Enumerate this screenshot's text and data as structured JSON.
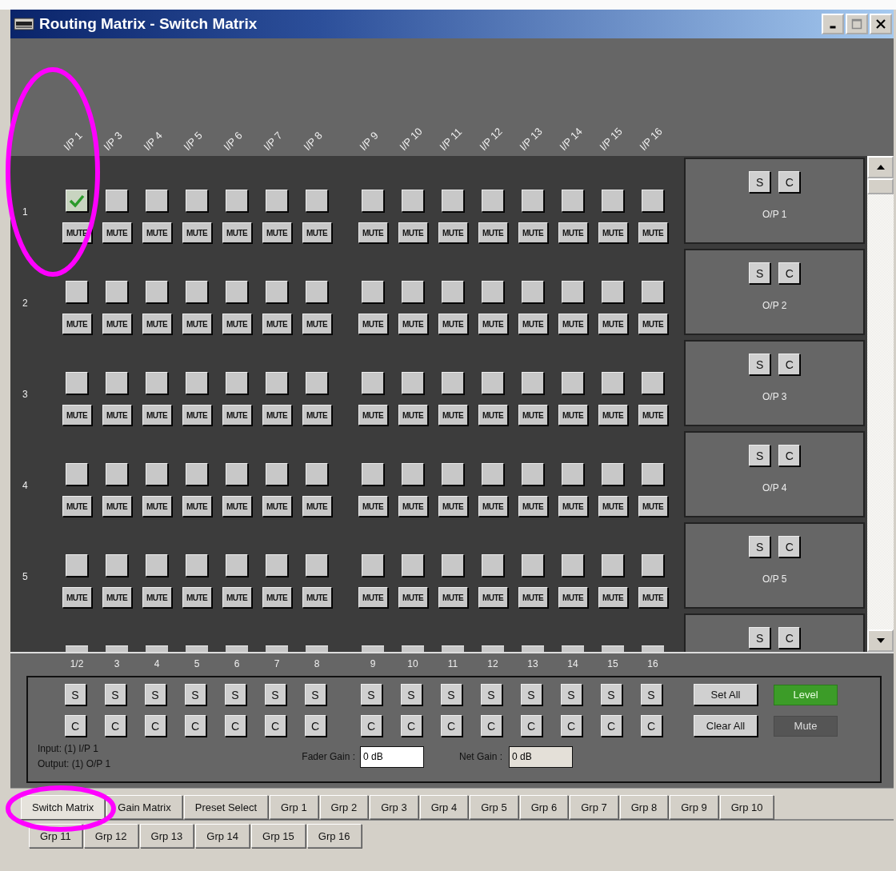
{
  "window": {
    "title": "Routing Matrix - Switch Matrix"
  },
  "input_headers": [
    "I/P 1",
    "I/P 3",
    "I/P 4",
    "I/P 5",
    "I/P 6",
    "I/P 7",
    "I/P 8",
    "I/P 9",
    "I/P 10",
    "I/P 11",
    "I/P 12",
    "I/P 13",
    "I/P 14",
    "I/P 15",
    "I/P 16"
  ],
  "rows": [
    {
      "label": "1",
      "cells": [
        {
          "checked": true,
          "mute": "MUTE"
        },
        {
          "checked": false,
          "mute": "MUTE"
        },
        {
          "checked": false,
          "mute": "MUTE"
        },
        {
          "checked": false,
          "mute": "MUTE"
        },
        {
          "checked": false,
          "mute": "MUTE"
        },
        {
          "checked": false,
          "mute": "MUTE"
        },
        {
          "checked": false,
          "mute": "MUTE"
        },
        {
          "checked": false,
          "mute": "MUTE"
        },
        {
          "checked": false,
          "mute": "MUTE"
        },
        {
          "checked": false,
          "mute": "MUTE"
        },
        {
          "checked": false,
          "mute": "MUTE"
        },
        {
          "checked": false,
          "mute": "MUTE"
        },
        {
          "checked": false,
          "mute": "MUTE"
        },
        {
          "checked": false,
          "mute": "MUTE"
        },
        {
          "checked": false,
          "mute": "MUTE"
        }
      ]
    },
    {
      "label": "2",
      "cells": [
        {
          "checked": false,
          "mute": "MUTE"
        },
        {
          "checked": false,
          "mute": "MUTE"
        },
        {
          "checked": false,
          "mute": "MUTE"
        },
        {
          "checked": false,
          "mute": "MUTE"
        },
        {
          "checked": false,
          "mute": "MUTE"
        },
        {
          "checked": false,
          "mute": "MUTE"
        },
        {
          "checked": false,
          "mute": "MUTE"
        },
        {
          "checked": false,
          "mute": "MUTE"
        },
        {
          "checked": false,
          "mute": "MUTE"
        },
        {
          "checked": false,
          "mute": "MUTE"
        },
        {
          "checked": false,
          "mute": "MUTE"
        },
        {
          "checked": false,
          "mute": "MUTE"
        },
        {
          "checked": false,
          "mute": "MUTE"
        },
        {
          "checked": false,
          "mute": "MUTE"
        },
        {
          "checked": false,
          "mute": "MUTE"
        }
      ]
    },
    {
      "label": "3",
      "cells": [
        {
          "checked": false,
          "mute": "MUTE"
        },
        {
          "checked": false,
          "mute": "MUTE"
        },
        {
          "checked": false,
          "mute": "MUTE"
        },
        {
          "checked": false,
          "mute": "MUTE"
        },
        {
          "checked": false,
          "mute": "MUTE"
        },
        {
          "checked": false,
          "mute": "MUTE"
        },
        {
          "checked": false,
          "mute": "MUTE"
        },
        {
          "checked": false,
          "mute": "MUTE"
        },
        {
          "checked": false,
          "mute": "MUTE"
        },
        {
          "checked": false,
          "mute": "MUTE"
        },
        {
          "checked": false,
          "mute": "MUTE"
        },
        {
          "checked": false,
          "mute": "MUTE"
        },
        {
          "checked": false,
          "mute": "MUTE"
        },
        {
          "checked": false,
          "mute": "MUTE"
        },
        {
          "checked": false,
          "mute": "MUTE"
        }
      ]
    },
    {
      "label": "4",
      "cells": [
        {
          "checked": false,
          "mute": "MUTE"
        },
        {
          "checked": false,
          "mute": "MUTE"
        },
        {
          "checked": false,
          "mute": "MUTE"
        },
        {
          "checked": false,
          "mute": "MUTE"
        },
        {
          "checked": false,
          "mute": "MUTE"
        },
        {
          "checked": false,
          "mute": "MUTE"
        },
        {
          "checked": false,
          "mute": "MUTE"
        },
        {
          "checked": false,
          "mute": "MUTE"
        },
        {
          "checked": false,
          "mute": "MUTE"
        },
        {
          "checked": false,
          "mute": "MUTE"
        },
        {
          "checked": false,
          "mute": "MUTE"
        },
        {
          "checked": false,
          "mute": "MUTE"
        },
        {
          "checked": false,
          "mute": "MUTE"
        },
        {
          "checked": false,
          "mute": "MUTE"
        },
        {
          "checked": false,
          "mute": "MUTE"
        }
      ]
    },
    {
      "label": "5",
      "cells": [
        {
          "checked": false,
          "mute": "MUTE"
        },
        {
          "checked": false,
          "mute": "MUTE"
        },
        {
          "checked": false,
          "mute": "MUTE"
        },
        {
          "checked": false,
          "mute": "MUTE"
        },
        {
          "checked": false,
          "mute": "MUTE"
        },
        {
          "checked": false,
          "mute": "MUTE"
        },
        {
          "checked": false,
          "mute": "MUTE"
        },
        {
          "checked": false,
          "mute": "MUTE"
        },
        {
          "checked": false,
          "mute": "MUTE"
        },
        {
          "checked": false,
          "mute": "MUTE"
        },
        {
          "checked": false,
          "mute": "MUTE"
        },
        {
          "checked": false,
          "mute": "MUTE"
        },
        {
          "checked": false,
          "mute": "MUTE"
        },
        {
          "checked": false,
          "mute": "MUTE"
        },
        {
          "checked": false,
          "mute": "MUTE"
        }
      ]
    },
    {
      "cells": [
        {
          "kind": "edge"
        },
        {
          "kind": "edge"
        },
        {
          "kind": "edge"
        },
        {
          "kind": "edge"
        },
        {
          "kind": "edge"
        },
        {
          "kind": "edge"
        },
        {
          "kind": "edge"
        },
        {
          "kind": "edge"
        },
        {
          "kind": "edge"
        },
        {
          "kind": "edge"
        },
        {
          "kind": "edge"
        },
        {
          "kind": "edge"
        },
        {
          "kind": "edge"
        },
        {
          "kind": "edge"
        },
        {
          "kind": "edge"
        }
      ]
    }
  ],
  "outputs": [
    {
      "set": "S",
      "clear": "C",
      "label": "O/P 1"
    },
    {
      "set": "S",
      "clear": "C",
      "label": "O/P 2"
    },
    {
      "set": "S",
      "clear": "C",
      "label": "O/P 3"
    },
    {
      "set": "S",
      "clear": "C",
      "label": "O/P 4"
    },
    {
      "set": "S",
      "clear": "C",
      "label": "O/P 5"
    },
    {
      "set": "S",
      "clear": "C"
    }
  ],
  "input_columns": [
    {
      "label": "1/2",
      "set": "S",
      "clear": "C"
    },
    {
      "label": "3",
      "set": "S",
      "clear": "C"
    },
    {
      "label": "4",
      "set": "S",
      "clear": "C"
    },
    {
      "label": "5",
      "set": "S",
      "clear": "C"
    },
    {
      "label": "6",
      "set": "S",
      "clear": "C"
    },
    {
      "label": "7",
      "set": "S",
      "clear": "C"
    },
    {
      "label": "8",
      "set": "S",
      "clear": "C"
    },
    {
      "label": "9",
      "set": "S",
      "clear": "C"
    },
    {
      "label": "10",
      "set": "S",
      "clear": "C"
    },
    {
      "label": "11",
      "set": "S",
      "clear": "C"
    },
    {
      "label": "12",
      "set": "S",
      "clear": "C"
    },
    {
      "label": "13",
      "set": "S",
      "clear": "C"
    },
    {
      "label": "14",
      "set": "S",
      "clear": "C"
    },
    {
      "label": "15",
      "set": "S",
      "clear": "C"
    },
    {
      "label": "16",
      "set": "S",
      "clear": "C"
    }
  ],
  "set_all": "Set All",
  "clear_all": "Clear All",
  "modes": [
    {
      "label": "Level",
      "selected": true
    },
    {
      "label": "Mute",
      "selected": false
    }
  ],
  "input_info": "Input: (1) I/P 1",
  "output_info": "Output: (1) O/P 1",
  "fader_gain": {
    "label": "Fader Gain :",
    "value": "0 dB"
  },
  "net_gain": {
    "label": "Net Gain :",
    "value": "0 dB"
  },
  "tab_rows": [
    [
      {
        "label": "Switch Matrix",
        "selected": true
      },
      {
        "label": "Gain Matrix",
        "selected": false
      },
      {
        "label": "Preset Select",
        "selected": false
      },
      {
        "label": "Grp 1",
        "selected": false
      },
      {
        "label": "Grp 2",
        "selected": false
      },
      {
        "label": "Grp 3",
        "selected": false
      },
      {
        "label": "Grp 4",
        "selected": false
      },
      {
        "label": "Grp 5",
        "selected": false
      },
      {
        "label": "Grp 6",
        "selected": false
      },
      {
        "label": "Grp 7",
        "selected": false
      },
      {
        "label": "Grp 8",
        "selected": false
      },
      {
        "label": "Grp 9",
        "selected": false
      },
      {
        "label": "Grp 10",
        "selected": false
      }
    ],
    [
      {
        "label": "Grp 11",
        "selected": false
      },
      {
        "label": "Grp 12",
        "selected": false
      },
      {
        "label": "Grp 13",
        "selected": false
      },
      {
        "label": "Grp 14",
        "selected": false
      },
      {
        "label": "Grp 15",
        "selected": false
      },
      {
        "label": "Grp 16",
        "selected": false
      }
    ]
  ]
}
